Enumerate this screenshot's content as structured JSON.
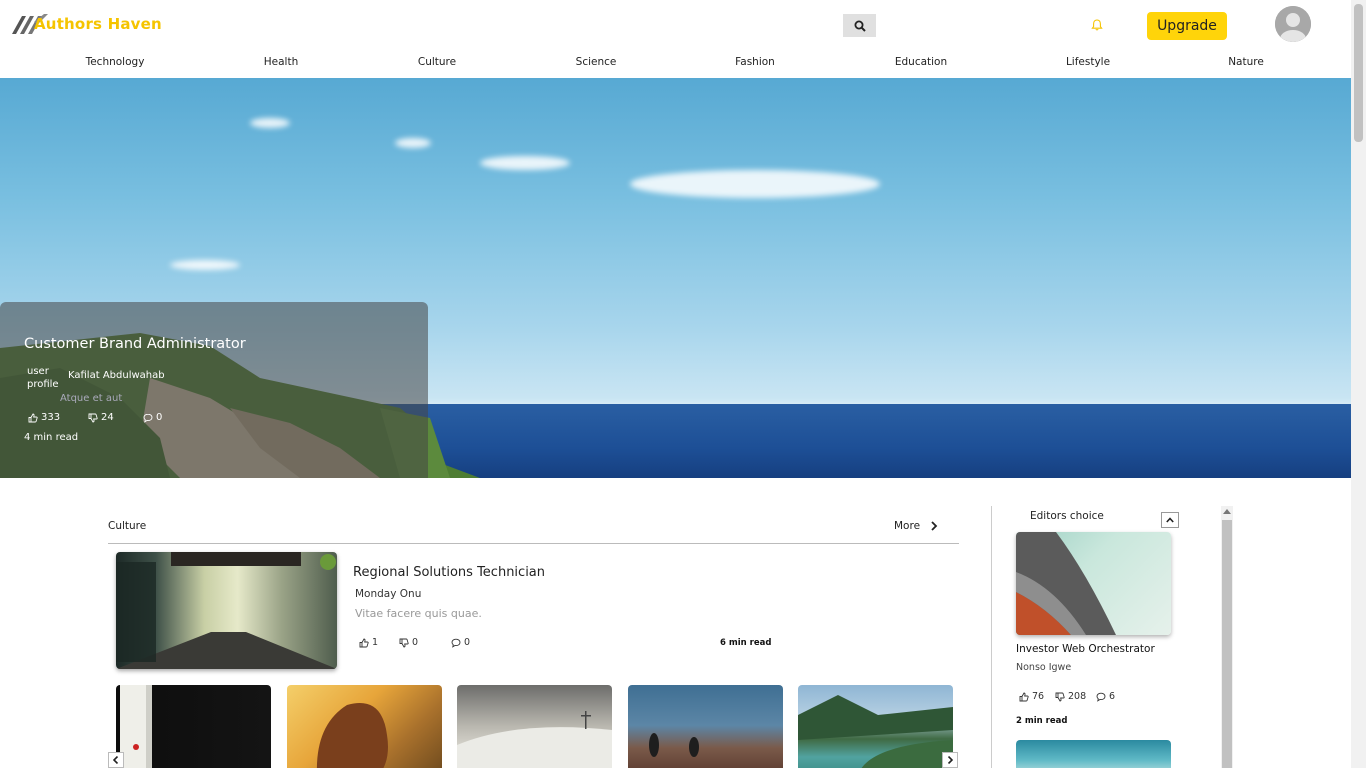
{
  "header": {
    "logo_text": "Authors Haven",
    "upgrade_label": "Upgrade",
    "icons": [
      "search-icon",
      "bell-icon",
      "avatar"
    ]
  },
  "nav": {
    "items": [
      "Technology",
      "Health",
      "Culture",
      "Science",
      "Fashion",
      "Education",
      "Lifestyle",
      "Nature"
    ]
  },
  "hero": {
    "title": "Customer Brand Administrator",
    "image_alt": "user profile",
    "author": "Kafilat Abdulwahab",
    "description": "Atque et aut",
    "likes": "333",
    "dislikes": "24",
    "comments": "0",
    "read_time": "4 min read"
  },
  "culture": {
    "section_title": "Culture",
    "more_label": "More",
    "featured": {
      "title": "Regional Solutions Technician",
      "author": "Monday Onu",
      "description": "Vitae facere quis quae.",
      "likes": "1",
      "dislikes": "0",
      "comments": "0",
      "read_time": "6 min read"
    }
  },
  "editors_choice": {
    "title": "Editors choice",
    "article": {
      "title": "Investor Web Orchestrator",
      "author": "Nonso Igwe",
      "likes": "76",
      "dislikes": "208",
      "comments": "6",
      "read_time": "2 min read"
    }
  },
  "colors": {
    "brand": "#f5c400",
    "upgrade": "#ffd40a"
  }
}
